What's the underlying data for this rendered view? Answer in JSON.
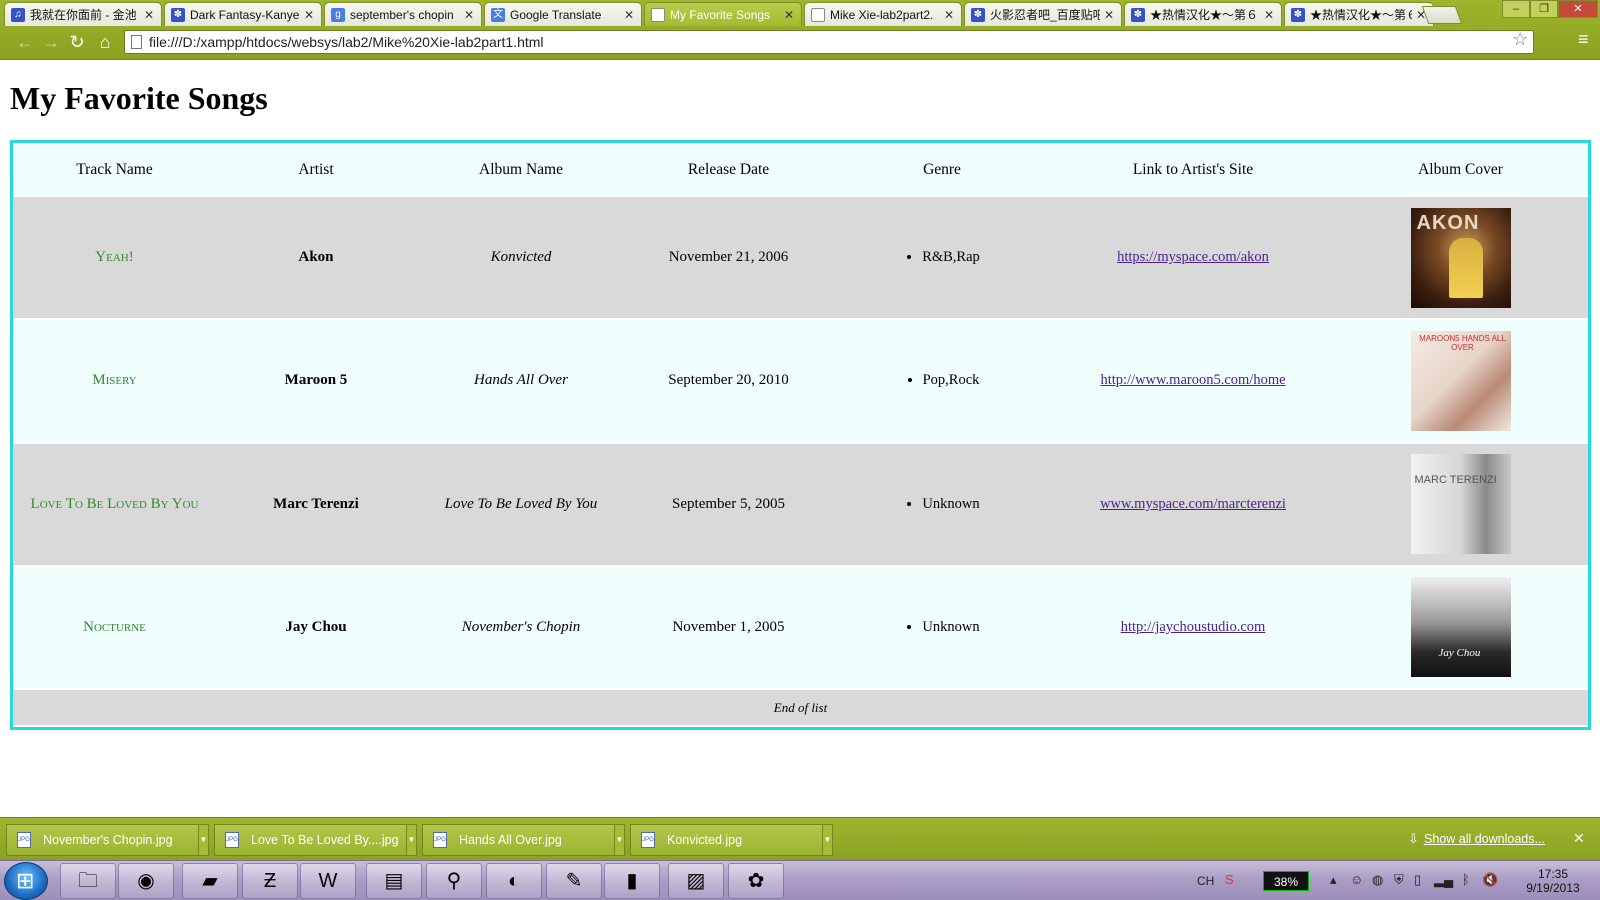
{
  "browser": {
    "tabs": [
      {
        "title": "我就在你面前 - 金池",
        "icon": "headphones-icon",
        "active": false
      },
      {
        "title": "Dark Fantasy-Kanye",
        "icon": "paw-icon",
        "active": false
      },
      {
        "title": "september's chopin",
        "icon": "google-icon",
        "active": false
      },
      {
        "title": "Google Translate",
        "icon": "translate-icon",
        "active": false
      },
      {
        "title": "My Favorite Songs",
        "icon": "page-icon",
        "active": true
      },
      {
        "title": "Mike Xie-lab2part2.",
        "icon": "page-icon",
        "active": false
      },
      {
        "title": "火影忍者吧_百度贴吧",
        "icon": "paw-icon",
        "active": false
      },
      {
        "title": "★热情汉化★～第６",
        "icon": "paw-icon",
        "active": false
      },
      {
        "title": "★热情汉化★～第６",
        "icon": "paw-icon",
        "active": false
      }
    ],
    "url": "file:///D:/xampp/htdocs/websys/lab2/Mike%20Xie-lab2part1.html"
  },
  "page": {
    "title": "My Favorite Songs",
    "columns": [
      "Track Name",
      "Artist",
      "Album Name",
      "Release Date",
      "Genre",
      "Link to Artist's Site",
      "Album Cover"
    ],
    "songs": [
      {
        "track": "Yeah!",
        "artist": "Akon",
        "album": "Konvicted",
        "release_date": "November 21, 2006",
        "genre": "R&B,Rap",
        "link": "https://myspace.com/akon",
        "cover_text": "AKON"
      },
      {
        "track": "Misery",
        "artist": "Maroon 5",
        "album": "Hands All Over",
        "release_date": "September 20, 2010",
        "genre": "Pop,Rock",
        "link": "http://www.maroon5.com/home",
        "cover_text": "MAROON5 HANDS ALL OVER"
      },
      {
        "track": "Love To Be Loved By You",
        "artist": "Marc Terenzi",
        "album": "Love To Be Loved By You",
        "release_date": "September 5, 2005",
        "genre": "Unknown",
        "link": "www.myspace.com/marcterenzi",
        "cover_text": "MARC TERENZI"
      },
      {
        "track": "Nocturne",
        "artist": "Jay Chou",
        "album": "November's Chopin",
        "release_date": "November 1, 2005",
        "genre": "Unknown",
        "link": "http://jaychoustudio.com",
        "cover_text": "Jay Chou"
      }
    ],
    "footer": "End of list"
  },
  "downloads": {
    "items": [
      "November's Chopin.jpg",
      "Love To Be Loved By....jpg",
      "Hands All Over.jpg",
      "Konvicted.jpg"
    ],
    "show_all": "Show all downloads..."
  },
  "taskbar": {
    "language": "CH",
    "battery": "38%",
    "time": "17:35",
    "date": "9/19/2013"
  }
}
